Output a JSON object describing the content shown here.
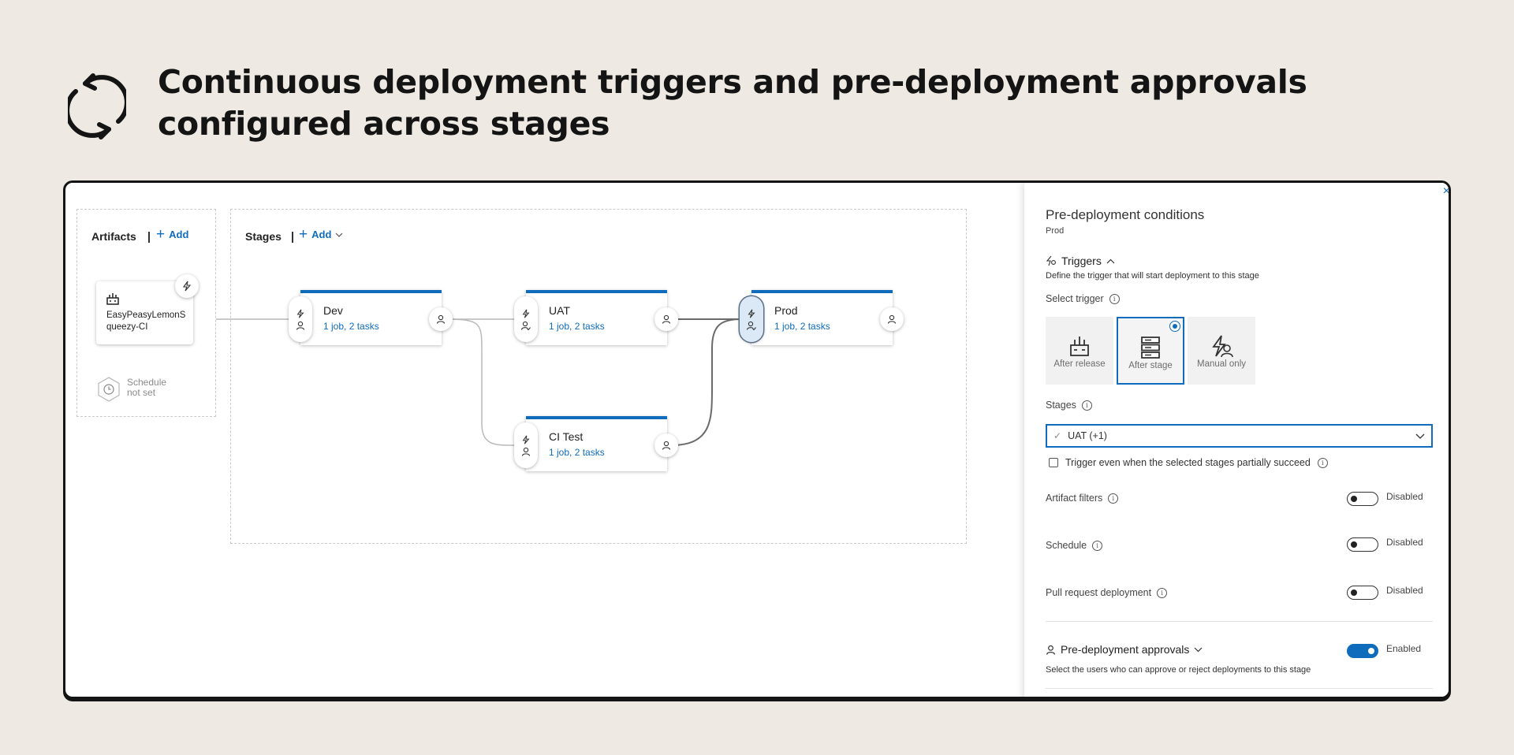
{
  "header": {
    "title": "Continuous deployment triggers and pre-deployment approvals configured across stages",
    "icon": "refresh-icon"
  },
  "pipeline": {
    "artifacts": {
      "title": "Artifacts",
      "add_label": "Add",
      "artifact_name": "EasyPeasyLemonSqueezy-CI",
      "schedule_text": "Schedule not set"
    },
    "stages": {
      "title": "Stages",
      "add_label": "Add",
      "items": [
        {
          "name": "Dev",
          "jobs": "1 job, 2 tasks"
        },
        {
          "name": "UAT",
          "jobs": "1 job, 2 tasks"
        },
        {
          "name": "Prod",
          "jobs": "1 job, 2 tasks"
        },
        {
          "name": "CI Test",
          "jobs": "1 job, 2 tasks"
        }
      ]
    }
  },
  "panel": {
    "title": "Pre-deployment conditions",
    "stage": "Prod",
    "close": "×",
    "triggers": {
      "heading": "Triggers",
      "description": "Define the trigger that will start deployment to this stage",
      "select_label": "Select trigger",
      "options": [
        {
          "label": "After release",
          "selected": false
        },
        {
          "label": "After stage",
          "selected": true
        },
        {
          "label": "Manual only",
          "selected": false
        }
      ],
      "stages_label": "Stages",
      "stages_value": "UAT (+1)",
      "partial_checkbox": "Trigger even when the selected stages partially succeed"
    },
    "options": [
      {
        "label": "Artifact filters",
        "state": "Disabled",
        "enabled": false
      },
      {
        "label": "Schedule",
        "state": "Disabled",
        "enabled": false
      },
      {
        "label": "Pull request deployment",
        "state": "Disabled",
        "enabled": false
      }
    ],
    "approvals": {
      "heading": "Pre-deployment approvals",
      "state": "Enabled",
      "enabled": true,
      "description": "Select the users who can approve or reject deployments to this stage"
    }
  },
  "colors": {
    "accent": "#0f6cbd",
    "background": "#eeeae3"
  }
}
